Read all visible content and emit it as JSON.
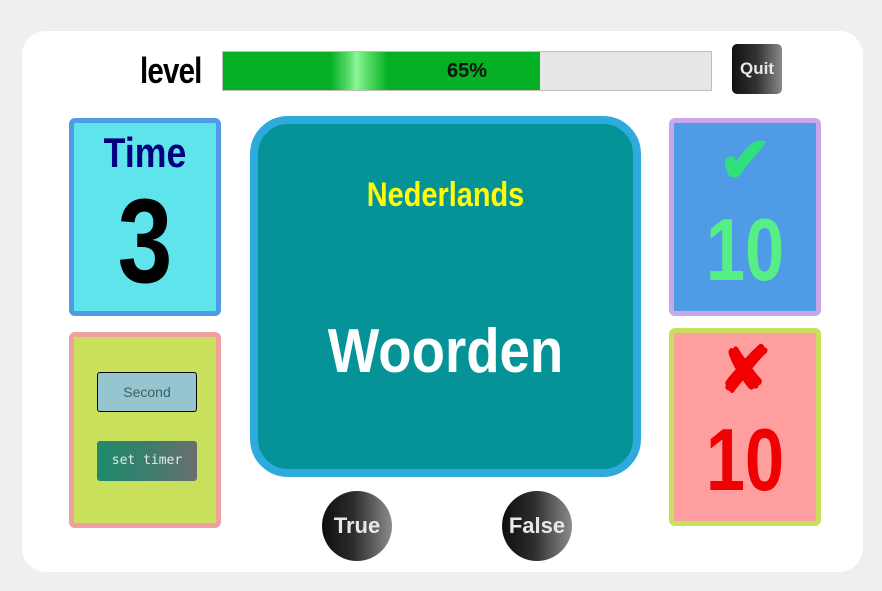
{
  "header": {
    "level_label": "level",
    "progress_percent": 65,
    "progress_text": "65%",
    "quit_label": "Quit"
  },
  "timer": {
    "label": "Time",
    "value": "3"
  },
  "settings": {
    "second_placeholder": "Second",
    "set_timer_label": "set timer"
  },
  "question": {
    "language": "Nederlands",
    "word": "Woorden"
  },
  "score": {
    "correct_icon": "check-icon",
    "correct_symbol": "✔",
    "correct_count": "10",
    "wrong_icon": "cross-icon",
    "wrong_symbol": "✘",
    "wrong_count": "10"
  },
  "answers": {
    "true_label": "True",
    "false_label": "False"
  },
  "colors": {
    "progress_fill": "#06b025",
    "main_card": "#059398",
    "main_border": "#2eabdc",
    "language_text": "#ffff00",
    "correct_text": "#55ef85",
    "wrong_text": "#f00000"
  }
}
